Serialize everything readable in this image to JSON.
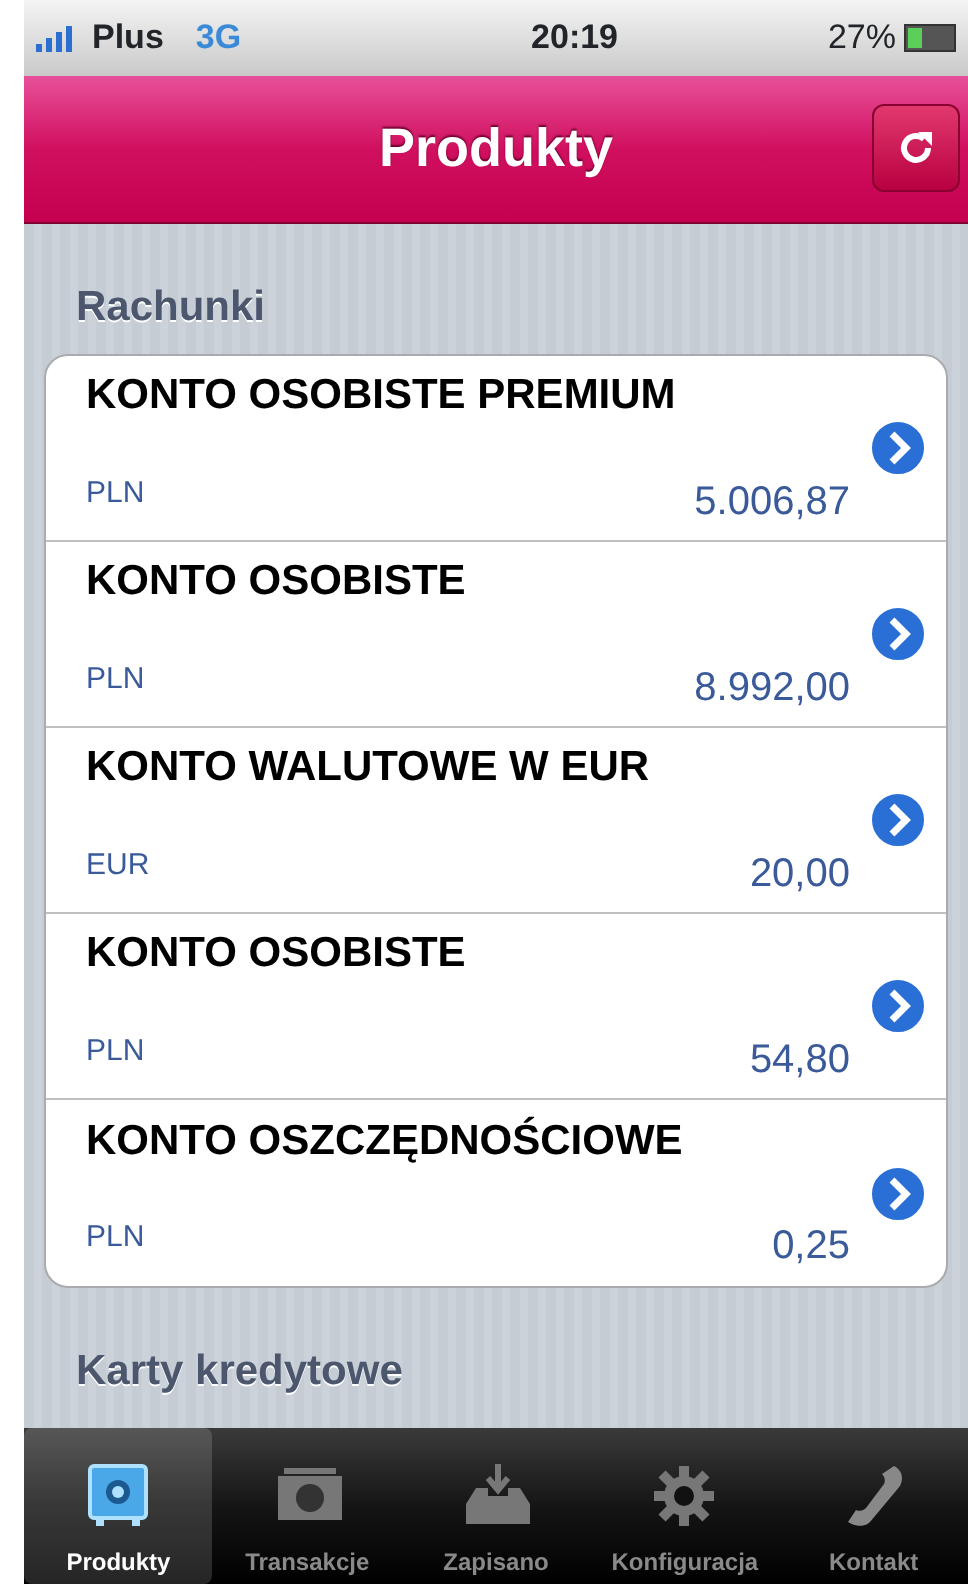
{
  "status_bar": {
    "carrier": "Plus",
    "network": "3G",
    "time": "20:19",
    "battery": "27%"
  },
  "nav_bar": {
    "title": "Produkty"
  },
  "sections": [
    {
      "title": "Rachunki",
      "accounts": [
        {
          "name": "KONTO OSOBISTE PREMIUM",
          "currency": "PLN",
          "balance": "5.006,87"
        },
        {
          "name": "KONTO OSOBISTE",
          "currency": "PLN",
          "balance": "8.992,00"
        },
        {
          "name": "KONTO WALUTOWE W EUR",
          "currency": "EUR",
          "balance": "20,00"
        },
        {
          "name": "KONTO OSOBISTE",
          "currency": "PLN",
          "balance": "54,80"
        },
        {
          "name": "KONTO OSZCZĘDNOŚCIOWE",
          "currency": "PLN",
          "balance": "0,25"
        }
      ]
    },
    {
      "title": "Karty kredytowe"
    }
  ],
  "tab_bar": [
    {
      "label": "Produkty",
      "kind": "safe",
      "selected": true
    },
    {
      "label": "Transakcje",
      "kind": "banknote",
      "selected": false
    },
    {
      "label": "Zapisano",
      "kind": "inbox",
      "selected": false
    },
    {
      "label": "Konfiguracja",
      "kind": "gear",
      "selected": false
    },
    {
      "label": "Kontakt",
      "kind": "phone",
      "selected": false
    }
  ]
}
